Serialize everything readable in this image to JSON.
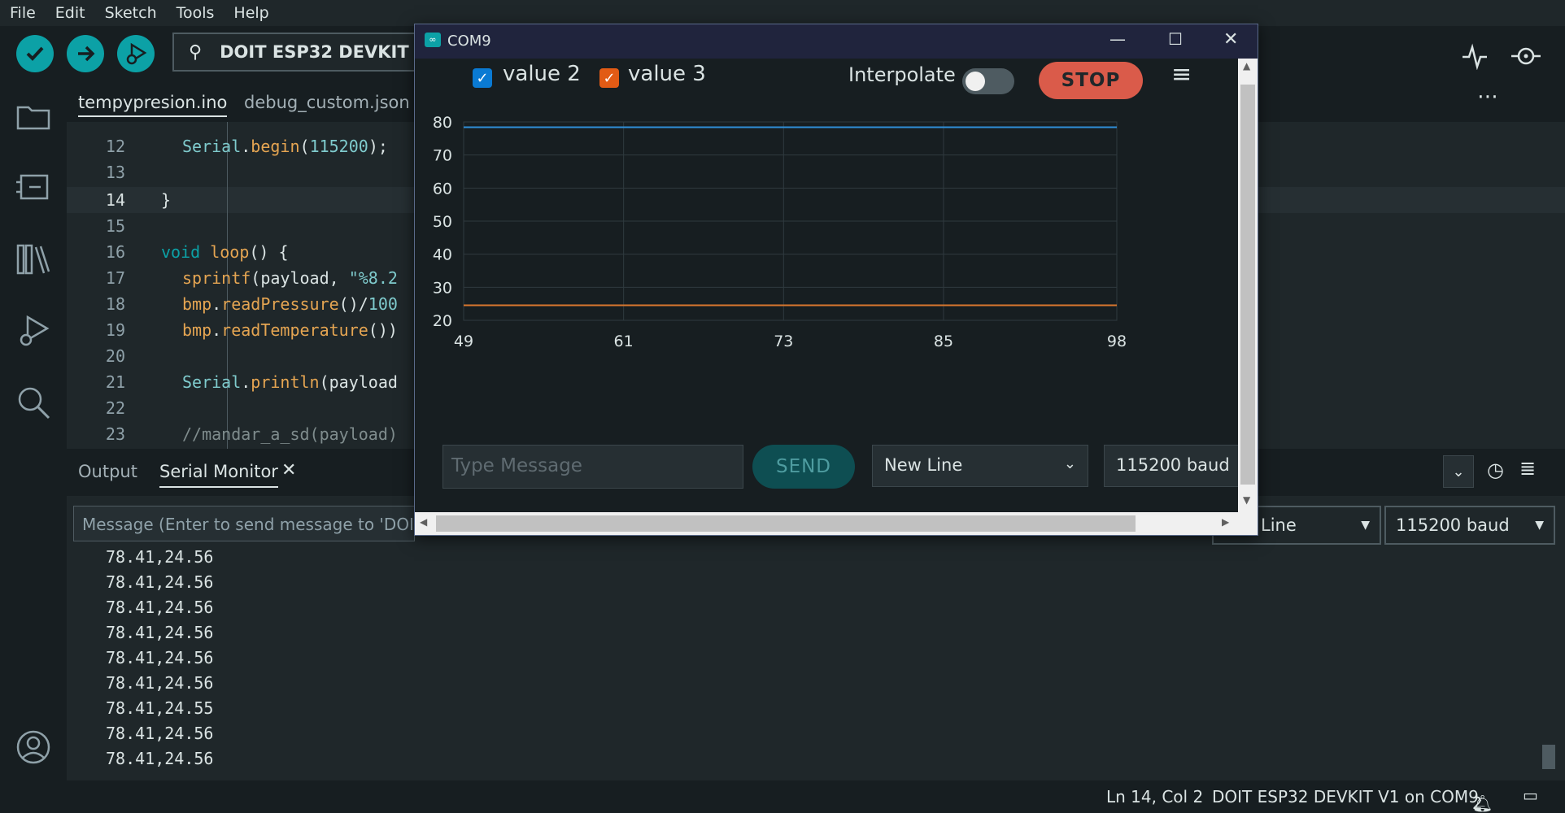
{
  "menu": [
    "File",
    "Edit",
    "Sketch",
    "Tools",
    "Help"
  ],
  "toolbar": {
    "board_label": "DOIT ESP32 DEVKIT V",
    "icons": [
      "verify-check-icon",
      "upload-arrow-icon",
      "debug-icon",
      "serial-plotter-icon",
      "serial-monitor-icon"
    ]
  },
  "sidebar_icons": [
    "folder-icon",
    "boards-icon",
    "library-icon",
    "debug-icon",
    "search-icon",
    "account-icon"
  ],
  "tabs": [
    "tempypresion.ino",
    "debug_custom.json"
  ],
  "editor": {
    "current_line": "14",
    "lines": [
      {
        "num": "12",
        "code": "Serial.begin(115200);"
      },
      {
        "num": "13",
        "code": ""
      },
      {
        "num": "14",
        "code": "}"
      },
      {
        "num": "15",
        "code": ""
      },
      {
        "num": "16",
        "code": "void loop() {"
      },
      {
        "num": "17",
        "code": "sprintf(payload, \"%8.2"
      },
      {
        "num": "18",
        "code": "bmp.readPressure()/100"
      },
      {
        "num": "19",
        "code": "bmp.readTemperature())"
      },
      {
        "num": "20",
        "code": ""
      },
      {
        "num": "21",
        "code": "Serial.println(payload"
      },
      {
        "num": "22",
        "code": ""
      },
      {
        "num": "23",
        "code": "//mandar_a_sd(payload)"
      }
    ]
  },
  "panel": {
    "tabs": [
      "Output",
      "Serial Monitor"
    ],
    "message_placeholder": "Message (Enter to send message to 'DOI",
    "line_ending": "Line",
    "baud": "115200 baud",
    "serial_lines": [
      "78.41,24.56",
      "78.41,24.56",
      "78.41,24.56",
      "78.41,24.56",
      "78.41,24.56",
      "78.41,24.56",
      "78.41,24.55",
      "78.41,24.56",
      "78.41,24.56"
    ]
  },
  "status": {
    "position": "Ln 14, Col 2",
    "board": "DOIT ESP32 DEVKIT V1 on COM9",
    "notifications": "2"
  },
  "plotter": {
    "title": "COM9",
    "series_labels": [
      "value 2",
      "value 3"
    ],
    "interpolate_label": "Interpolate",
    "stop_label": "STOP",
    "message_placeholder": "Type Message",
    "send_label": "SEND",
    "line_ending": "New Line",
    "baud": "115200 baud",
    "colors": {
      "value2": "#0a7ad3",
      "value3": "#e25b15"
    }
  },
  "chart_data": {
    "type": "line",
    "x": [
      49,
      98
    ],
    "xlim": [
      49,
      98
    ],
    "ylim": [
      20,
      80
    ],
    "x_ticks": [
      49,
      61,
      73,
      85,
      98
    ],
    "y_ticks": [
      80,
      70,
      60,
      50,
      40,
      30,
      20
    ],
    "grid": true,
    "series": [
      {
        "name": "value 2",
        "color": "#2f8fd8",
        "values": [
          78.41,
          78.41
        ]
      },
      {
        "name": "value 3",
        "color": "#d8772e",
        "values": [
          24.56,
          24.56
        ]
      }
    ]
  }
}
